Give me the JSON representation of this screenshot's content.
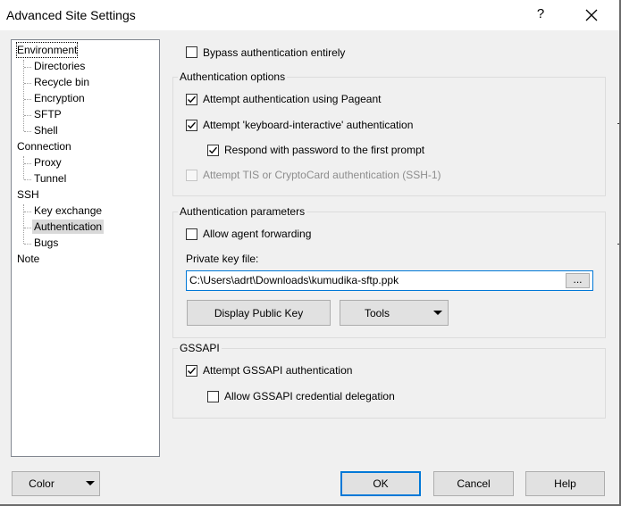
{
  "window": {
    "title": "Advanced Site Settings",
    "help_label": "?"
  },
  "tree": {
    "items": [
      {
        "label": "Environment",
        "level": 0,
        "selected": false
      },
      {
        "label": "Directories",
        "level": 1
      },
      {
        "label": "Recycle bin",
        "level": 1
      },
      {
        "label": "Encryption",
        "level": 1
      },
      {
        "label": "SFTP",
        "level": 1
      },
      {
        "label": "Shell",
        "level": 1
      },
      {
        "label": "Connection",
        "level": 0
      },
      {
        "label": "Proxy",
        "level": 1
      },
      {
        "label": "Tunnel",
        "level": 1
      },
      {
        "label": "SSH",
        "level": 0
      },
      {
        "label": "Key exchange",
        "level": 1
      },
      {
        "label": "Authentication",
        "level": 1,
        "selected": true
      },
      {
        "label": "Bugs",
        "level": 1
      },
      {
        "label": "Note",
        "level": 0
      }
    ]
  },
  "bypass": {
    "label": "Bypass authentication entirely",
    "checked": false
  },
  "auth_options": {
    "title": "Authentication options",
    "pageant": {
      "label": "Attempt authentication using Pageant",
      "checked": true
    },
    "keyboard_interactive": {
      "label": "Attempt 'keyboard-interactive' authentication",
      "checked": true
    },
    "respond_password": {
      "label": "Respond with password to the first prompt",
      "checked": true
    },
    "tis": {
      "label": "Attempt TIS or CryptoCard authentication (SSH-1)",
      "checked": false,
      "disabled": true
    }
  },
  "auth_params": {
    "title": "Authentication parameters",
    "agent_forwarding": {
      "label": "Allow agent forwarding",
      "checked": false
    },
    "private_key_label": "Private key file:",
    "private_key_value": "C:\\Users\\adrt\\Downloads\\kumudika-sftp.ppk",
    "browse_label": "...",
    "display_public_key_label": "Display Public Key",
    "tools_label": "Tools"
  },
  "gssapi": {
    "title": "GSSAPI",
    "attempt": {
      "label": "Attempt GSSAPI authentication",
      "checked": true
    },
    "delegation": {
      "label": "Allow GSSAPI credential delegation",
      "checked": false
    }
  },
  "footer": {
    "color_label": "Color",
    "ok_label": "OK",
    "cancel_label": "Cancel",
    "help_label": "Help"
  },
  "colors": {
    "focus_border": "#0078d7",
    "button_face": "#e1e1e1",
    "dialog_bg": "#f0f0f0"
  }
}
